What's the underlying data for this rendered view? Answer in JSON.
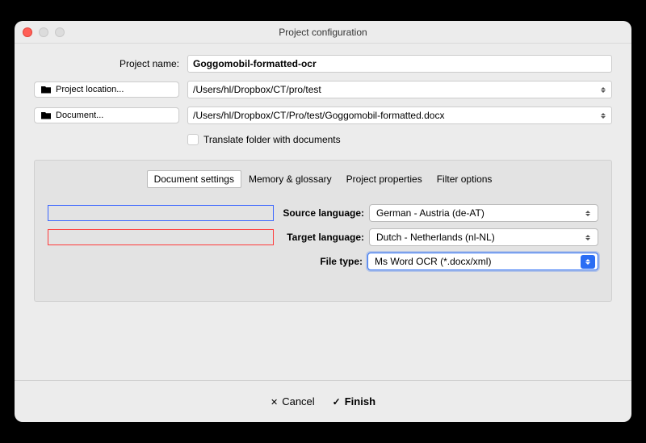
{
  "window": {
    "title": "Project configuration"
  },
  "form": {
    "project_name_label": "Project name:",
    "project_name_value": "Goggomobil-formatted-ocr",
    "project_location_btn": "Project location...",
    "project_location_value": "/Users/hl/Dropbox/CT/pro/test",
    "document_btn": "Document...",
    "document_value": "/Users/hl/Dropbox/CT/Pro/test/Goggomobil-formatted.docx",
    "translate_folder_label": "Translate folder with documents"
  },
  "tabs": {
    "t0": "Document settings",
    "t1": "Memory & glossary",
    "t2": "Project properties",
    "t3": "Filter options"
  },
  "settings": {
    "source_label": "Source language:",
    "source_value": "German - Austria (de-AT)",
    "target_label": "Target language:",
    "target_value": "Dutch - Netherlands (nl-NL)",
    "filetype_label": "File type:",
    "filetype_value": "Ms Word OCR (*.docx/xml)"
  },
  "footer": {
    "cancel": "Cancel",
    "finish": "Finish"
  }
}
